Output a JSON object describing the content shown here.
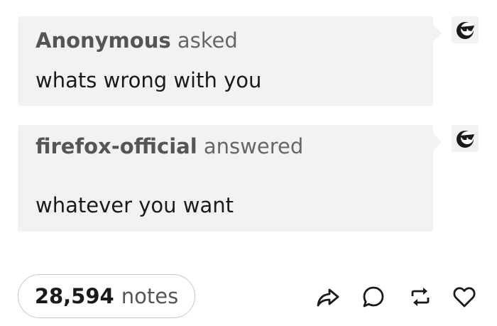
{
  "question": {
    "author": "Anonymous",
    "verb": "asked",
    "text": "whats wrong with you",
    "avatar_icon": "sunglasses-avatar-icon"
  },
  "answer": {
    "author": "firefox-official",
    "verb": "answered",
    "text": "whatever you want",
    "avatar_icon": "sunglasses-avatar-icon"
  },
  "footer": {
    "notes_count": "28,594",
    "notes_label": "notes",
    "actions": [
      "share-icon",
      "reply-icon",
      "reblog-icon",
      "like-icon"
    ]
  },
  "colors": {
    "bubble_bg": "#f2f2f2",
    "text": "#1a1a1a",
    "muted": "#666666"
  }
}
